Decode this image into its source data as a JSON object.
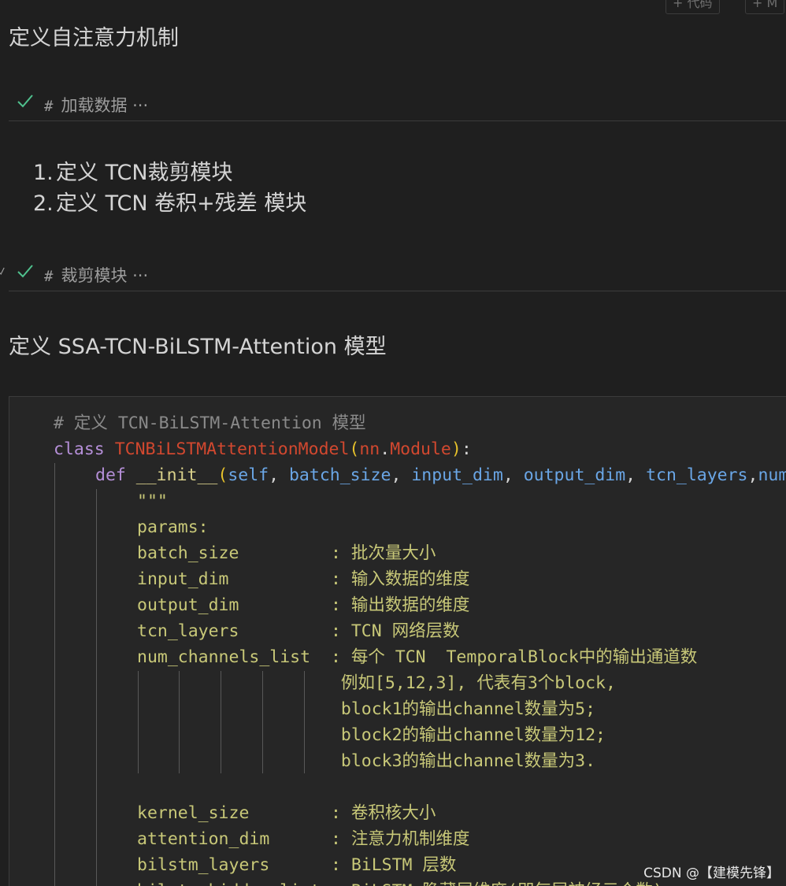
{
  "toolbar": {
    "add_code_label": "+ 代码",
    "add_markdown_label": "+ M"
  },
  "cells": {
    "heading_attention": "定义自注意力机制",
    "collapsed_load": {
      "hash": "#",
      "title": "加载数据 ···"
    },
    "list_items": [
      {
        "num": "1.",
        "text": "定义 TCN裁剪模块"
      },
      {
        "num": "2.",
        "text": "定义 TCN 卷积+残差 模块"
      }
    ],
    "collapsed_crop": {
      "hash": "#",
      "title": "裁剪模块 ···"
    },
    "heading_model": "定义 SSA-TCN-BiLSTM-Attention 模型"
  },
  "code": {
    "comment": "# 定义 TCN-BiLSTM-Attention 模型",
    "class_kw": "class",
    "class_name": "TCNBiLSTMAttentionModel",
    "base_mod": "nn",
    "base_cls": "Module",
    "def_kw": "def",
    "func_name": "__init__",
    "params": [
      "self",
      "batch_size",
      "input_dim",
      "output_dim",
      "tcn_layers",
      "num"
    ],
    "docstring_lines": [
      "\"\"\"",
      "params:",
      "batch_size         : 批次量大小",
      "input_dim          : 输入数据的维度",
      "output_dim         : 输出数据的维度",
      "tcn_layers         : TCN 网络层数",
      "num_channels_list  : 每个 TCN  TemporalBlock中的输出通道数",
      "                    例如[5,12,3], 代表有3个block,",
      "                    block1的输出channel数量为5;",
      "                    block2的输出channel数量为12;",
      "                    block3的输出channel数量为3.",
      "",
      "kernel_size        : 卷积核大小",
      "attention_dim      : 注意力机制维度",
      "bilstm_layers      : BiLSTM 层数",
      "bilstm_hidden_list : BiLSTM 隐藏层维度(即每层神经元个数)"
    ]
  },
  "watermark": "CSDN @【建模先锋】"
}
